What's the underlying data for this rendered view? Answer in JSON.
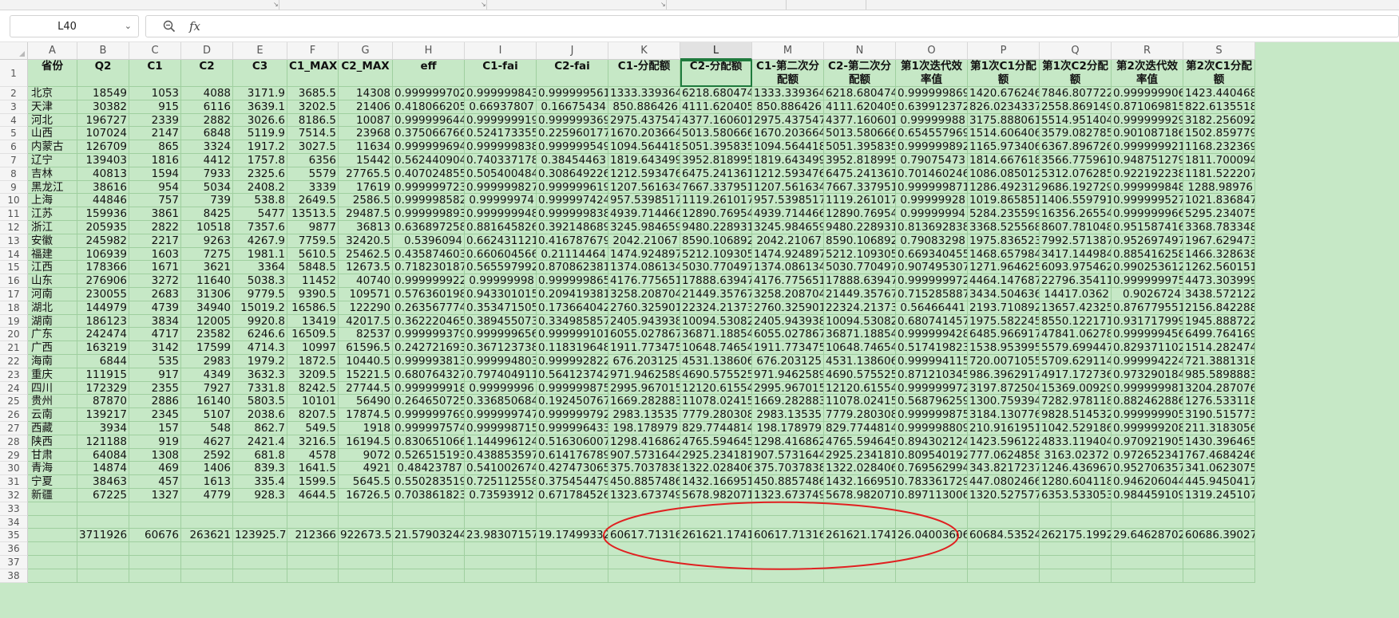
{
  "app": {
    "name_box": "L40",
    "formula_icon": "fx",
    "formula_value": ""
  },
  "icons": {
    "zoom": "zoom-icon",
    "chevron": "chevron-down-icon"
  },
  "colors": {
    "cell_fill": "#c6e8c6",
    "selection": "#1f7a3d",
    "annotation": "#e02020"
  },
  "columns": [
    "A",
    "B",
    "C",
    "D",
    "E",
    "F",
    "G",
    "H",
    "I",
    "J",
    "K",
    "L",
    "M",
    "N",
    "O",
    "P",
    "Q",
    "R",
    "S"
  ],
  "selected_column": "L",
  "headers": [
    "省份",
    "Q2",
    "C1",
    "C2",
    "C3",
    "C1_MAX",
    "C2_MAX",
    "eff",
    "C1-fai",
    "C2-fai",
    "C1-分配额",
    "C2-分配额",
    "C1-第二次分配额",
    "C2-第二次分配额",
    "第1次迭代效率值",
    "第1次C1分配额",
    "第1次C2分配额",
    "第2次迭代效率值",
    "第2次C1分配额"
  ],
  "row_numbers": [
    "1",
    "2",
    "3",
    "4",
    "5",
    "6",
    "7",
    "8",
    "9",
    "10",
    "11",
    "12",
    "13",
    "14",
    "15",
    "16",
    "17",
    "18",
    "19",
    "20",
    "21",
    "22",
    "23",
    "24",
    "25",
    "26",
    "27",
    "28",
    "29",
    "30",
    "31",
    "32",
    "33",
    "34",
    "35",
    "36",
    "37",
    "38"
  ],
  "rows": [
    [
      "北京",
      "18549",
      "1053",
      "4088",
      "3171.9",
      "3685.5",
      "14308",
      "0.999999702",
      "0.999999843",
      "0.999999561",
      "1333.339364",
      "6218.680474",
      "1333.339364",
      "6218.680474",
      "0.999999869",
      "1420.676246",
      "7846.807722",
      "0.999999906",
      "1423.440468"
    ],
    [
      "天津",
      "30382",
      "915",
      "6116",
      "3639.1",
      "3202.5",
      "21406",
      "0.418066205",
      "0.66937807",
      "0.16675434",
      "850.886426",
      "4111.620405",
      "850.886426",
      "4111.620405",
      "0.639912372",
      "826.0234337",
      "2558.869149",
      "0.871069815",
      "822.6135518"
    ],
    [
      "河北",
      "196727",
      "2339",
      "2882",
      "3026.6",
      "8186.5",
      "10087",
      "0.999999644",
      "0.999999919",
      "0.999999369",
      "2975.437547",
      "4377.160601",
      "2975.437547",
      "4377.160601",
      "0.99999988",
      "3175.888061",
      "5514.951404",
      "0.999999929",
      "3182.256092"
    ],
    [
      "山西",
      "107024",
      "2147",
      "6848",
      "5119.9",
      "7514.5",
      "23968",
      "0.375066766",
      "0.524173355",
      "0.225960177",
      "1670.203664",
      "5013.580666",
      "1670.203664",
      "5013.580666",
      "0.654557969",
      "1514.606406",
      "3579.082785",
      "0.901087186",
      "1502.859779"
    ],
    [
      "内蒙古",
      "126709",
      "865",
      "3324",
      "1917.2",
      "3027.5",
      "11634",
      "0.999999694",
      "0.999999838",
      "0.999999549",
      "1094.564418",
      "5051.395835",
      "1094.564418",
      "5051.395835",
      "0.999999892",
      "1165.973406",
      "6367.896726",
      "0.999999921",
      "1168.232369"
    ],
    [
      "辽宁",
      "139403",
      "1816",
      "4412",
      "1757.8",
      "6356",
      "15442",
      "0.562440904",
      "0.740337178",
      "0.38454463",
      "1819.643499",
      "3952.818995",
      "1819.643499",
      "3952.818995",
      "0.79075473",
      "1814.667618",
      "3566.775961",
      "0.948751279",
      "1811.700094"
    ],
    [
      "吉林",
      "40813",
      "1594",
      "7933",
      "2325.6",
      "5579",
      "27765.5",
      "0.407024855",
      "0.505400484",
      "0.308649226",
      "1212.593476",
      "6475.241361",
      "1212.593476",
      "6475.241361",
      "0.701460246",
      "1086.085012",
      "5312.076285",
      "0.922192238",
      "1181.522207"
    ],
    [
      "黑龙江",
      "38616",
      "954",
      "5034",
      "2408.2",
      "3339",
      "17619",
      "0.999999723",
      "0.999999827",
      "0.999999619",
      "1207.561634",
      "7667.337951",
      "1207.561634",
      "7667.337951",
      "0.999999871",
      "1286.492312",
      "9686.192729",
      "0.999999848",
      "1288.98976"
    ],
    [
      "上海",
      "44846",
      "757",
      "739",
      "538.8",
      "2649.5",
      "2586.5",
      "0.999998582",
      "0.99999974",
      "0.999997424",
      "957.5398517",
      "1119.261017",
      "957.5398517",
      "1119.261017",
      "0.99999928",
      "1019.865851",
      "1406.559791",
      "0.999999527",
      "1021.836847"
    ],
    [
      "江苏",
      "159936",
      "3861",
      "8425",
      "5477",
      "13513.5",
      "29487.5",
      "0.999999893",
      "0.999999948",
      "0.999999838",
      "4939.714466",
      "12890.76954",
      "4939.714466",
      "12890.76954",
      "0.99999994",
      "5284.235599",
      "16356.26554",
      "0.999999966",
      "5295.234075"
    ],
    [
      "浙江",
      "205935",
      "2822",
      "10518",
      "7357.6",
      "9877",
      "36813",
      "0.636897258",
      "0.881645826",
      "0.392148689",
      "3245.984659",
      "9480.228931",
      "3245.984659",
      "9480.228931",
      "0.813692838",
      "3368.525568",
      "8607.781048",
      "0.951587416",
      "3368.783348"
    ],
    [
      "安徽",
      "245982",
      "2217",
      "9263",
      "4267.9",
      "7759.5",
      "32420.5",
      "0.5396094",
      "0.662431121",
      "0.416787679",
      "2042.21067",
      "8590.106892",
      "2042.21067",
      "8590.106892",
      "0.79083298",
      "1975.836523",
      "7992.571387",
      "0.952697497",
      "1967.629473"
    ],
    [
      "福建",
      "106939",
      "1603",
      "7275",
      "1981.1",
      "5610.5",
      "25462.5",
      "0.435874603",
      "0.660604566",
      "0.21114464",
      "1474.924897",
      "5212.109305",
      "1474.924897",
      "5212.109305",
      "0.669340455",
      "1468.657984",
      "3417.144984",
      "0.885416258",
      "1466.328638"
    ],
    [
      "江西",
      "178366",
      "1671",
      "3621",
      "3364",
      "5848.5",
      "12673.5",
      "0.718230187",
      "0.565597992",
      "0.870862381",
      "1374.086134",
      "5030.770497",
      "1374.086134",
      "5030.770497",
      "0.907495307",
      "1271.964625",
      "6093.975462",
      "0.990253612",
      "1262.560151"
    ],
    [
      "山东",
      "276906",
      "3272",
      "11640",
      "5038.3",
      "11452",
      "40740",
      "0.999999922",
      "0.99999998",
      "0.999999865",
      "4176.775651",
      "17888.63947",
      "4176.775651",
      "17888.63947",
      "0.999999972",
      "4464.147687",
      "22796.35411",
      "0.999999975",
      "4473.303999"
    ],
    [
      "河南",
      "230055",
      "2683",
      "31306",
      "9779.5",
      "9390.5",
      "109571",
      "0.576360198",
      "0.943301015",
      "0.209419381",
      "3258.208704",
      "21449.35767",
      "3258.208704",
      "21449.35767",
      "0.715285887",
      "3434.504636",
      "14417.0362",
      "0.9026724",
      "3438.572122"
    ],
    [
      "湖北",
      "144979",
      "4739",
      "34940",
      "15019.2",
      "16586.5",
      "122290",
      "0.263567774",
      "0.353471505",
      "0.173664042",
      "2760.325901",
      "22324.21373",
      "2760.325901",
      "22324.21373",
      "0.56466441",
      "2193.710892",
      "13657.42325",
      "0.876779551",
      "2156.842288"
    ],
    [
      "湖南",
      "186123",
      "3834",
      "12005",
      "9920.8",
      "13419",
      "42017.5",
      "0.362220465",
      "0.389455073",
      "0.334985857",
      "2405.943938",
      "10094.53082",
      "2405.943938",
      "10094.53082",
      "0.680741457",
      "1975.582245",
      "8550.122171",
      "0.931717999",
      "1945.888722"
    ],
    [
      "广东",
      "242474",
      "4717",
      "23582",
      "6246.6",
      "16509.5",
      "82537",
      "0.999999379",
      "0.999999656",
      "0.999999101",
      "6055.027867",
      "36871.18854",
      "6055.027867",
      "36871.18854",
      "0.999999428",
      "6485.966917",
      "47841.06278",
      "0.999999456",
      "6499.764169"
    ],
    [
      "广西",
      "163219",
      "3142",
      "17599",
      "4714.3",
      "10997",
      "61596.5",
      "0.242721693",
      "0.367123738",
      "0.118319648",
      "1911.773475",
      "10648.74654",
      "1911.773475",
      "10648.74654",
      "0.517419823",
      "1538.953995",
      "5579.699447",
      "0.829371102",
      "1514.282474"
    ],
    [
      "海南",
      "6844",
      "535",
      "2983",
      "1979.2",
      "1872.5",
      "10440.5",
      "0.999993813",
      "0.999994803",
      "0.999992822",
      "676.203125",
      "4531.138606",
      "676.203125",
      "4531.138606",
      "0.999994115",
      "720.0071055",
      "5709.629114",
      "0.999994224",
      "721.3881318"
    ],
    [
      "重庆",
      "111915",
      "917",
      "4349",
      "3632.3",
      "3209.5",
      "15221.5",
      "0.680764327",
      "0.797404911",
      "0.564123742",
      "971.9462589",
      "4690.575525",
      "971.9462589",
      "4690.575525",
      "0.871210345",
      "986.3962917",
      "4917.172736",
      "0.973290184",
      "985.5898883"
    ],
    [
      "四川",
      "172329",
      "2355",
      "7927",
      "7331.8",
      "8242.5",
      "27744.5",
      "0.999999918",
      "0.99999996",
      "0.999999875",
      "2995.967015",
      "12120.61554",
      "2995.967015",
      "12120.61554",
      "0.999999972",
      "3197.872504",
      "15369.00929",
      "0.999999981",
      "3204.287076"
    ],
    [
      "贵州",
      "87870",
      "2886",
      "16140",
      "5803.5",
      "10101",
      "56490",
      "0.264650725",
      "0.336850684",
      "0.192450767",
      "1669.282883",
      "11078.02415",
      "1669.282883",
      "11078.02415",
      "0.568796259",
      "1300.759394",
      "7282.978118",
      "0.882462886",
      "1276.533118"
    ],
    [
      "云南",
      "139217",
      "2345",
      "5107",
      "2038.6",
      "8207.5",
      "17874.5",
      "0.999999769",
      "0.999999747",
      "0.999999792",
      "2983.13535",
      "7779.280308",
      "2983.13535",
      "7779.280308",
      "0.999999875",
      "3184.130776",
      "9828.514532",
      "0.999999905",
      "3190.515773"
    ],
    [
      "西藏",
      "3934",
      "157",
      "548",
      "862.7",
      "549.5",
      "1918",
      "0.999997574",
      "0.999998715",
      "0.999996433",
      "198.178979",
      "829.7744814",
      "198.178979",
      "829.7744814",
      "0.999998809",
      "210.9161951",
      "1042.529186",
      "0.999999208",
      "211.3183056"
    ],
    [
      "陕西",
      "121188",
      "919",
      "4627",
      "2421.4",
      "3216.5",
      "16194.5",
      "0.830651066",
      "1.144996124",
      "0.516306007",
      "1298.416862",
      "4765.594645",
      "1298.416862",
      "4765.594645",
      "0.894302124",
      "1423.596122",
      "4833.119404",
      "0.970921905",
      "1430.396465"
    ],
    [
      "甘肃",
      "64084",
      "1308",
      "2592",
      "681.8",
      "4578",
      "9072",
      "0.526515193",
      "0.438853597",
      "0.614176789",
      "907.5731644",
      "2925.234181",
      "907.5731644",
      "2925.234181",
      "0.809540192",
      "777.0624858",
      "3163.02372",
      "0.972652341",
      "767.4684246"
    ],
    [
      "青海",
      "14874",
      "469",
      "1406",
      "839.3",
      "1641.5",
      "4921",
      "0.48423787",
      "0.541002674",
      "0.427473065",
      "375.7037838",
      "1322.028406",
      "375.7037838",
      "1322.028406",
      "0.769562994",
      "343.8217237",
      "1246.436967",
      "0.952706357",
      "341.0623075"
    ],
    [
      "宁夏",
      "38463",
      "457",
      "1613",
      "335.4",
      "1599.5",
      "5645.5",
      "0.550283519",
      "0.725112558",
      "0.375454479",
      "450.8857486",
      "1432.166951",
      "450.8857486",
      "1432.166951",
      "0.783361729",
      "447.0802466",
      "1280.604118",
      "0.946206044",
      "445.9450417"
    ],
    [
      "新疆",
      "67225",
      "1327",
      "4779",
      "928.3",
      "4644.5",
      "16726.5",
      "0.703861823",
      "0.73593912",
      "0.671784526",
      "1323.673749",
      "5678.982071",
      "1323.673749",
      "5678.982071",
      "0.897113006",
      "1320.527577",
      "6353.533053",
      "0.984459109",
      "1319.245107"
    ]
  ],
  "totals_row_number": "35",
  "totals": [
    "",
    "3711926",
    "60676",
    "263621",
    "123925.7",
    "212366",
    "922673.5",
    "21.57903244",
    "23.98307157",
    "19.17499332",
    "60617.71316",
    "261621.1741",
    "60617.71316",
    "261621.1741",
    "26.04003606",
    "60684.53524",
    "262175.1992",
    "29.64628702",
    "60686.39027"
  ]
}
